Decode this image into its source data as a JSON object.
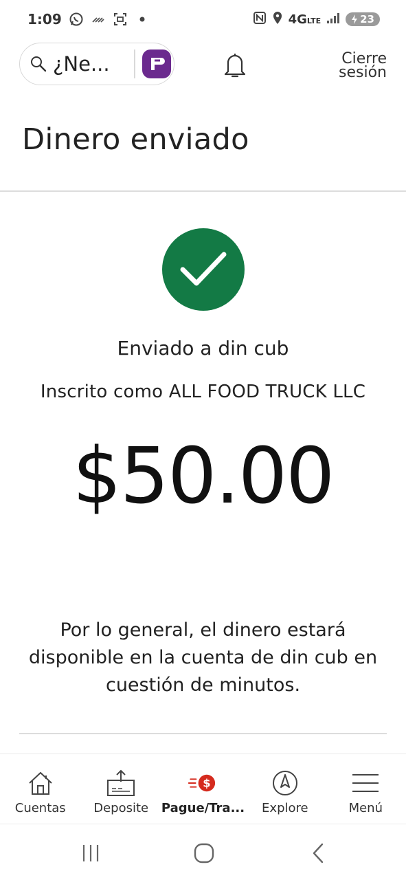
{
  "status_bar": {
    "time": "1:09",
    "network": "4G",
    "network_sub": "LTE",
    "battery": "23"
  },
  "header": {
    "search_text": "¿Ne...",
    "logout_line1": "Cierre",
    "logout_line2": "sesión"
  },
  "page": {
    "title": "Dinero enviado"
  },
  "confirmation": {
    "sent_to": "Enviado a din cub",
    "enrolled_as": "Inscrito como ALL FOOD TRUCK LLC",
    "amount": "$50.00",
    "note": "Por lo general, el dinero estará disponible en la cuenta de din cub en cuestión de minutos.",
    "success_color": "#137a45"
  },
  "bottom_nav": {
    "items": [
      {
        "label": "Cuentas",
        "icon": "home-icon"
      },
      {
        "label": "Deposite",
        "icon": "deposit-icon"
      },
      {
        "label": "Pague/Tra...",
        "icon": "pay-transfer-icon",
        "active": true
      },
      {
        "label": "Explore",
        "icon": "compass-icon"
      },
      {
        "label": "Menú",
        "icon": "menu-icon"
      }
    ]
  },
  "colors": {
    "accent_red": "#d52b1e",
    "brand_purple": "#6b2a8e"
  }
}
